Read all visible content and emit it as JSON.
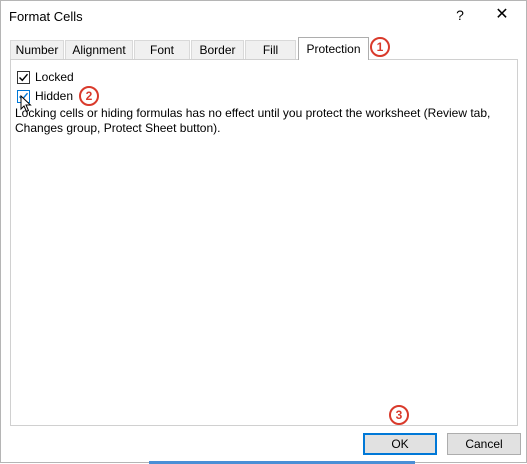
{
  "window": {
    "title": "Format Cells",
    "help_label": "?",
    "close_label": "✕"
  },
  "tabs": [
    {
      "label": "Number",
      "active": false
    },
    {
      "label": "Alignment",
      "active": false
    },
    {
      "label": "Font",
      "active": false
    },
    {
      "label": "Border",
      "active": false
    },
    {
      "label": "Fill",
      "active": false
    },
    {
      "label": "Protection",
      "active": true
    }
  ],
  "protection": {
    "locked": {
      "label": "Locked",
      "checked": true
    },
    "hidden": {
      "label": "Hidden",
      "checked": true
    },
    "note": "Locking cells or hiding formulas has no effect until you protect the worksheet (Review tab, Changes group, Protect Sheet button)."
  },
  "buttons": {
    "ok_label": "OK",
    "cancel_label": "Cancel"
  },
  "annotations": {
    "step1": "1",
    "step2": "2",
    "step3": "3"
  },
  "colors": {
    "accent": "#0078d7",
    "annotation": "#d93a2b"
  }
}
